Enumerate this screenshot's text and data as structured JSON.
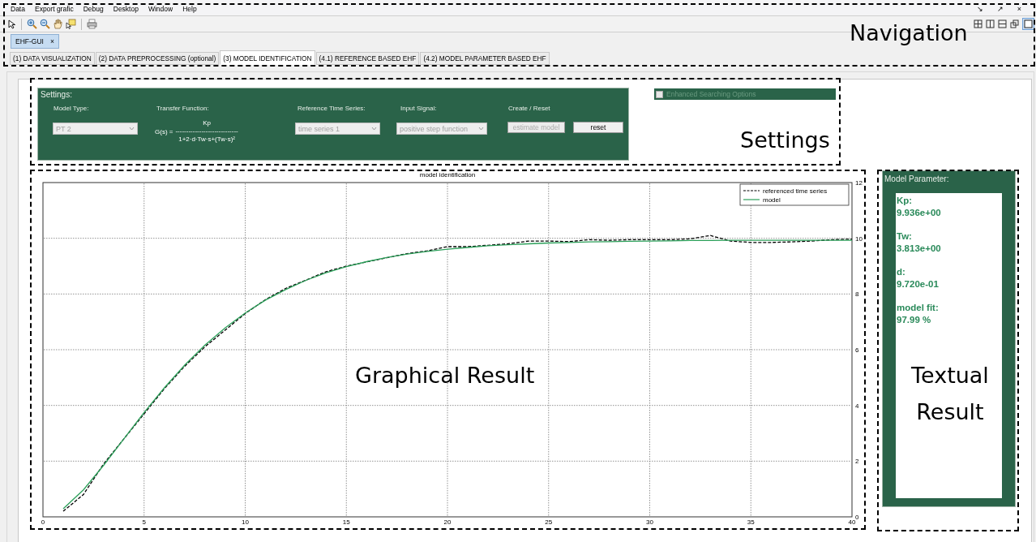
{
  "menu": [
    "Data",
    "Export grafic",
    "Debug",
    "Desktop",
    "Window",
    "Help"
  ],
  "document_tabs": [
    {
      "label": "EHF-GUI",
      "selected": true,
      "close": "×"
    }
  ],
  "window_controls": [
    "↘",
    "↗",
    "×"
  ],
  "tabs": [
    {
      "label": "(1) DATA VISUALIZATION",
      "selected": false
    },
    {
      "label": "(2) DATA PREPROCESSING (optional)",
      "selected": false
    },
    {
      "label": "(3) MODEL IDENTIFICATION",
      "selected": true
    },
    {
      "label": "(4.1) REFERENCE BASED EHF",
      "selected": false
    },
    {
      "label": "(4.2) MODEL PARAMETER BASED EHF",
      "selected": false
    }
  ],
  "settings": {
    "title": "Settings:",
    "model_type": {
      "label": "Model Type:",
      "value": "PT 2",
      "disabled": true
    },
    "transfer_function": {
      "label": "Transfer Function:",
      "lhs": "G(s) =",
      "numerator": "Kp",
      "fraction_bar": "-----------------------------",
      "denominator": "1+2·d·Tw·s+(Tw·s)²"
    },
    "reference": {
      "label": "Reference Time Series:",
      "value": "time series 1",
      "disabled": true
    },
    "input_signal": {
      "label": "Input Signal:",
      "value": "positive step function",
      "disabled": true
    },
    "create_reset": {
      "label": "Create / Reset",
      "buttons": [
        {
          "label": "estimate model",
          "disabled": true
        },
        {
          "label": "reset",
          "disabled": false
        }
      ]
    },
    "enhanced": {
      "label": "Enhanced Searching Options",
      "checked": false,
      "disabled": true
    }
  },
  "chart": {
    "chart_data": {
      "type": "line",
      "title": "model identification",
      "grid": true,
      "legend": true,
      "x": [
        1,
        2,
        3,
        4,
        5,
        6,
        7,
        8,
        9,
        10,
        11,
        12,
        13,
        14,
        15,
        16,
        17,
        18,
        19,
        20,
        21,
        22,
        23,
        24,
        25,
        26,
        27,
        28,
        29,
        30,
        31,
        32,
        33,
        34,
        35,
        36,
        37,
        38,
        39,
        40
      ],
      "series": [
        {
          "name": "referenced time series",
          "color": "#000000",
          "line_style": "dashed",
          "values": [
            0.2,
            0.8,
            1.9,
            2.8,
            3.7,
            4.6,
            5.4,
            6.1,
            6.7,
            7.3,
            7.8,
            8.2,
            8.5,
            8.8,
            9.0,
            9.15,
            9.3,
            9.45,
            9.55,
            9.7,
            9.7,
            9.75,
            9.8,
            9.9,
            9.9,
            9.88,
            9.95,
            9.93,
            9.95,
            9.95,
            9.95,
            9.98,
            10.1,
            9.9,
            9.85,
            9.85,
            9.87,
            9.9,
            9.95,
            9.97
          ]
        },
        {
          "name": "model",
          "color": "#2ca05a",
          "line_style": "solid",
          "values": [
            0.29,
            0.97,
            1.85,
            2.8,
            3.75,
            4.63,
            5.44,
            6.16,
            6.78,
            7.32,
            7.78,
            8.16,
            8.49,
            8.76,
            8.98,
            9.16,
            9.31,
            9.43,
            9.53,
            9.61,
            9.67,
            9.73,
            9.77,
            9.8,
            9.83,
            9.85,
            9.87,
            9.88,
            9.89,
            9.9,
            9.91,
            9.92,
            9.92,
            9.93,
            9.93,
            9.93,
            9.93,
            9.93,
            9.93,
            9.93
          ]
        }
      ],
      "xlim": [
        0,
        40
      ],
      "ylim": [
        0,
        12
      ],
      "xticks": [
        0,
        5,
        10,
        15,
        20,
        25,
        30,
        35,
        40
      ],
      "yticks": [
        0,
        2,
        4,
        6,
        8,
        10,
        12
      ]
    }
  },
  "parameters": {
    "title": "Model Parameter:",
    "items": [
      {
        "name": "Kp:",
        "value": "9.936e+00"
      },
      {
        "name": "Tw:",
        "value": "3.813e+00"
      },
      {
        "name": "d:",
        "value": "9.720e-01"
      },
      {
        "name": "model fit:",
        "value": "97.99 %"
      }
    ]
  },
  "annotations": [
    {
      "kind": "navigation",
      "label": "Navigation"
    },
    {
      "kind": "settings",
      "label": "Settings"
    },
    {
      "kind": "graphical",
      "label": "Graphical Result"
    },
    {
      "kind": "textual",
      "label": "Textual Result"
    }
  ]
}
